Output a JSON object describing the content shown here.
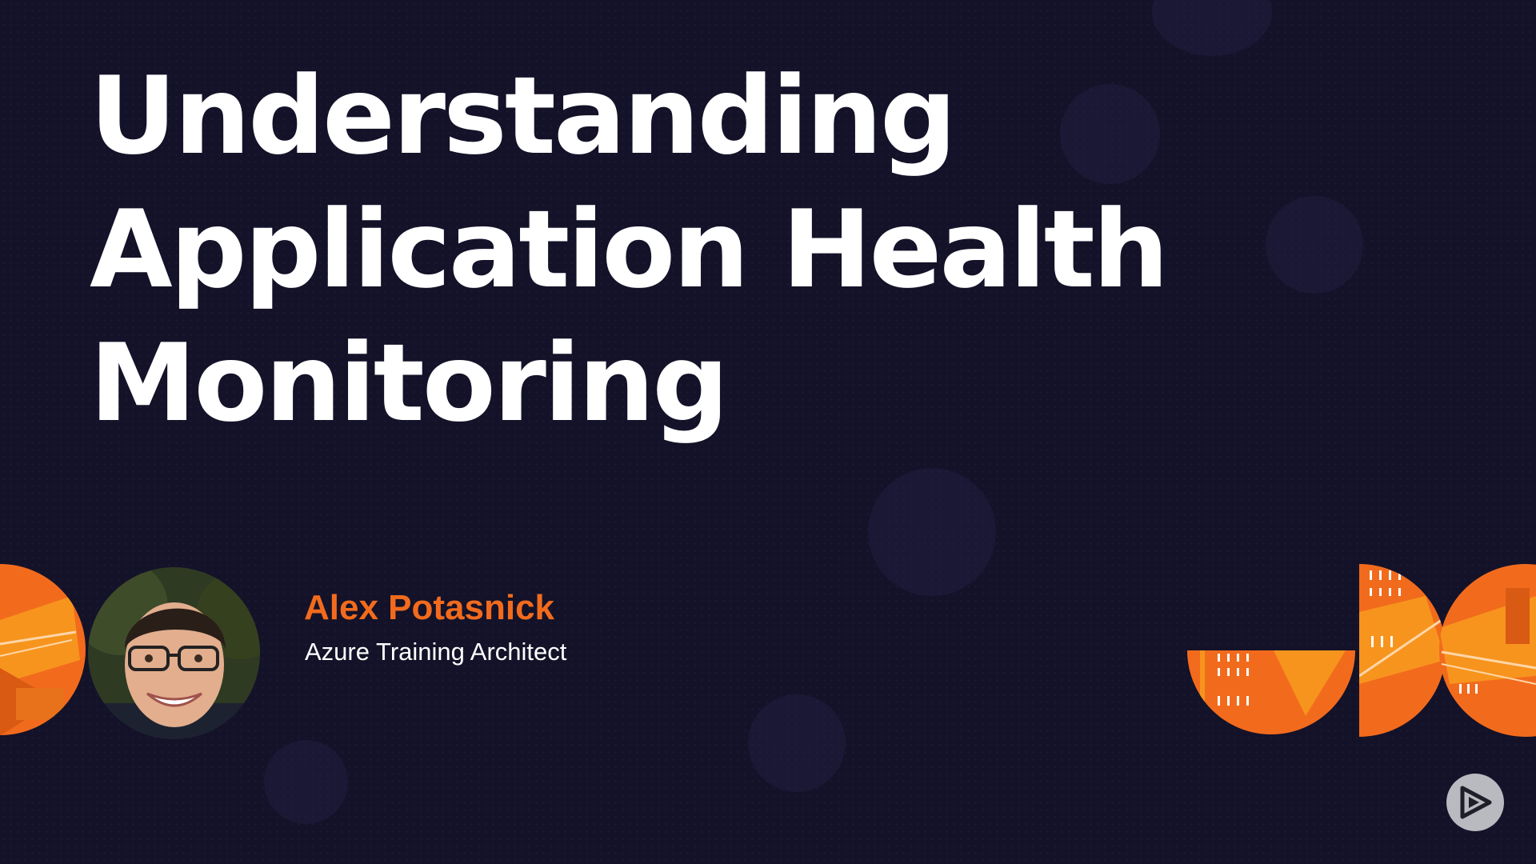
{
  "slide": {
    "title_lines": [
      "Understanding",
      "Application Health",
      "Monitoring"
    ],
    "presenter": {
      "name": "Alex Potasnick",
      "role": "Azure Training Architect"
    }
  },
  "colors": {
    "background": "#141228",
    "accent_orange": "#f26b1d",
    "title_text": "#ffffff"
  },
  "icons": {
    "logo": "pluralsight-play-icon"
  }
}
